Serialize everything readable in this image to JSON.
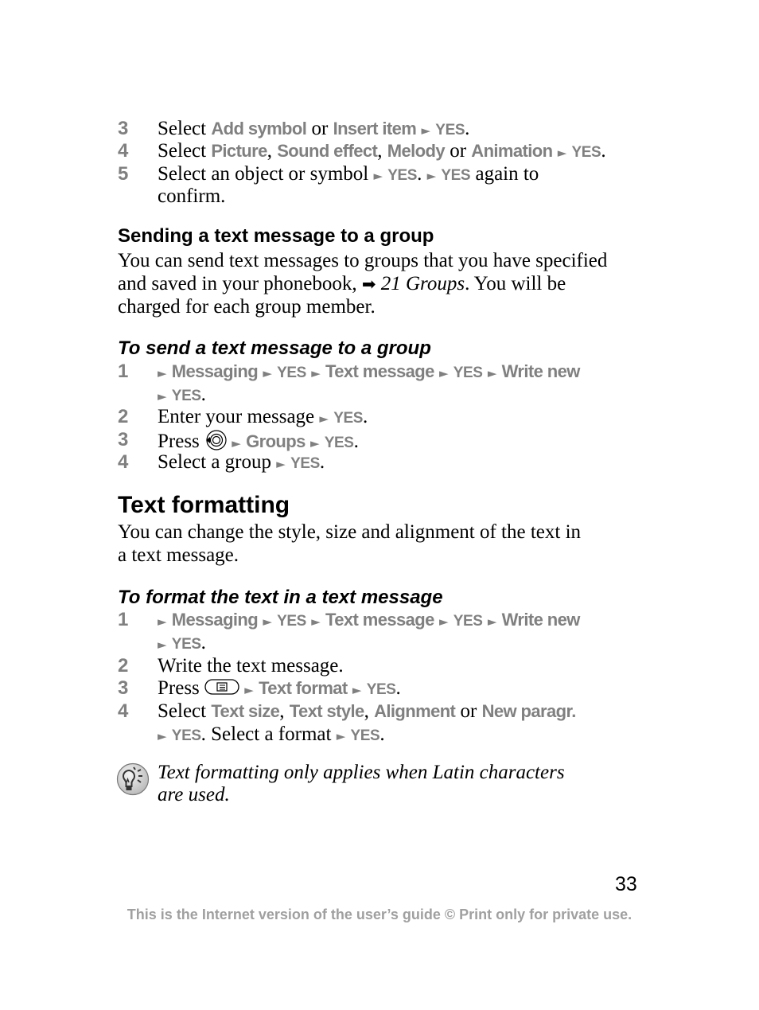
{
  "page": {
    "number": "33",
    "footer": "This is the Internet version of the user’s guide © Print only for private use."
  },
  "icons": {
    "menu_arrow": "►",
    "cross_ref": "➡",
    "joystick": "navigation-key-icon",
    "options_key": "options-key-icon",
    "tip": "lightbulb-tip-icon"
  },
  "steps_top": [
    {
      "num": "3",
      "pre": "Select ",
      "a": "Add symbol",
      "mid": " or ",
      "b": "Insert item",
      "yes": "YES",
      "end": "."
    },
    {
      "num": "4",
      "pre": "Select ",
      "a": "Picture",
      "c1": ", ",
      "b": "Sound effect",
      "c2": ", ",
      "c": "Melody",
      "mid": " or ",
      "d": "Animation",
      "yes": "YES",
      "end": "."
    },
    {
      "num": "5",
      "pre": "Select an object or symbol ",
      "yes": "YES",
      "dot": ". ",
      "yes2": "YES",
      "post": " again to",
      "line2": "confirm."
    }
  ],
  "section_group": {
    "heading": "Sending a text message to a group",
    "para_line1": "You can send text messages to groups that you have specified",
    "para_line2_pre": "and saved in your phonebook, ",
    "para_line2_ref": "21 Groups",
    "para_line2_post": ". You will be",
    "para_line3": "charged for each group member."
  },
  "procedure_group": {
    "heading": "To send a text message to a group",
    "steps": [
      {
        "num": "1",
        "m1": "Messaging",
        "yes1": "YES",
        "m2": "Text message",
        "yes2": "YES",
        "m3": "Write new",
        "yes3": "YES",
        "end": "."
      },
      {
        "num": "2",
        "text": "Enter your message ",
        "yes": "YES",
        "end": "."
      },
      {
        "num": "3",
        "text": "Press ",
        "item": "Groups",
        "yes": "YES",
        "end": "."
      },
      {
        "num": "4",
        "text": "Select a group ",
        "yes": "YES",
        "end": "."
      }
    ]
  },
  "section_format": {
    "heading": "Text formatting",
    "para_line1": "You can change the style, size and alignment of the text in",
    "para_line2": "a text message."
  },
  "procedure_format": {
    "heading": "To format the text in a text message",
    "steps": [
      {
        "num": "1",
        "m1": "Messaging",
        "yes1": "YES",
        "m2": "Text message",
        "yes2": "YES",
        "m3": "Write new",
        "yes3": "YES",
        "end": "."
      },
      {
        "num": "2",
        "text": "Write the text message."
      },
      {
        "num": "3",
        "text": "Press ",
        "item": "Text format",
        "yes": "YES",
        "end": "."
      },
      {
        "num": "4",
        "pre": "Select ",
        "a": "Text size",
        "c1": ", ",
        "b": "Text style",
        "c2": ", ",
        "c": "Alignment",
        "mid": " or ",
        "d": "New paragr.",
        "yes": "YES",
        "post": ". Select a format ",
        "yes2": "YES",
        "end": "."
      }
    ]
  },
  "tip": {
    "line1": "Text formatting only applies when Latin characters",
    "line2": "are used."
  }
}
